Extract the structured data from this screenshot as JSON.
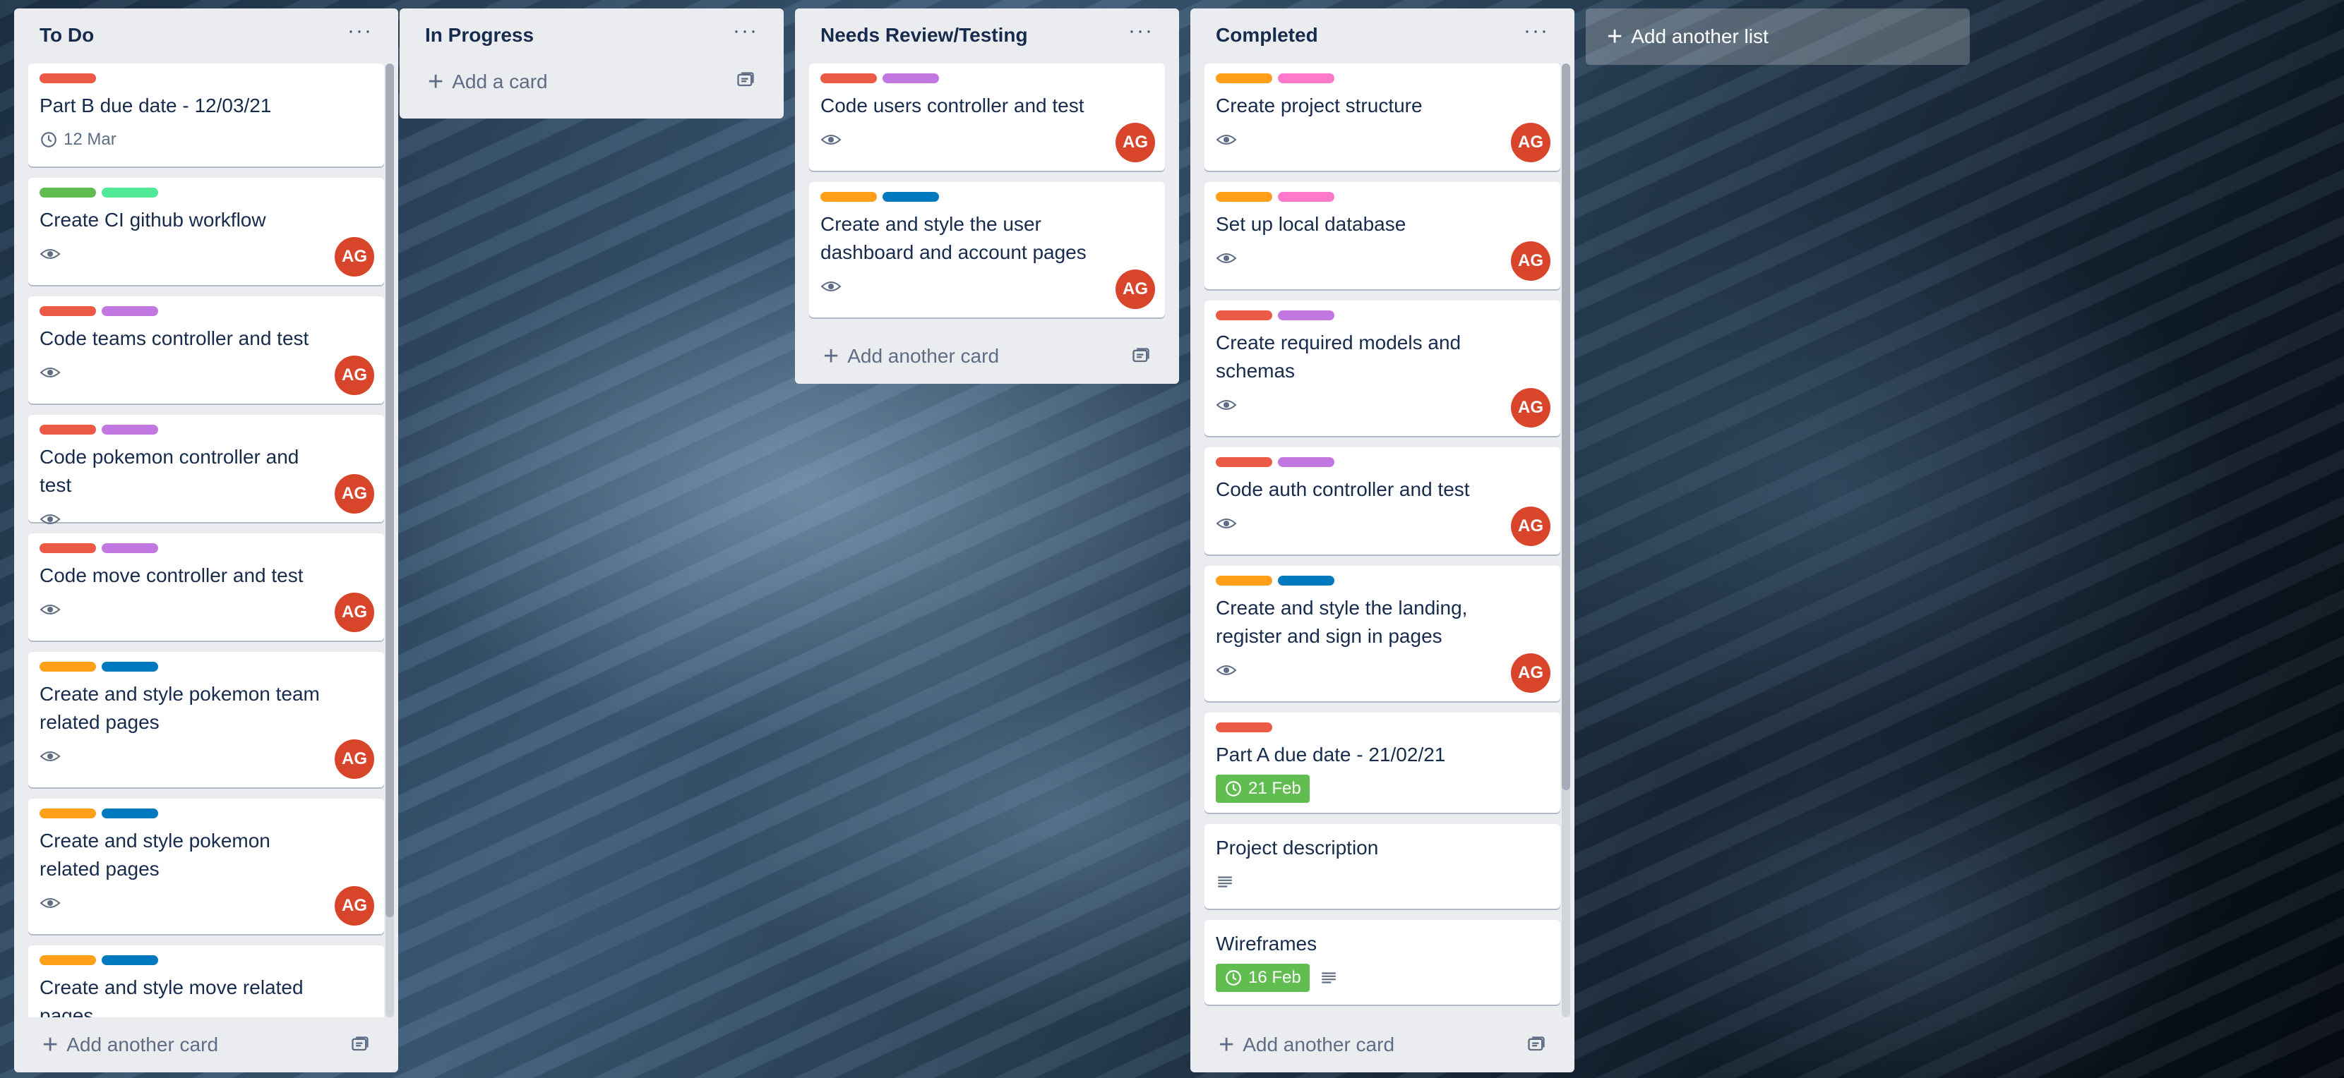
{
  "colors": {
    "red": "#eb5a46",
    "purple": "#c377e0",
    "green": "#61bd4f",
    "lime": "#51e898",
    "orange": "#ff9f1a",
    "pink": "#ff78cb",
    "blue": "#0079bf",
    "avatar": "#d9452b"
  },
  "icons": {
    "watch": "eye-icon",
    "due": "clock-icon",
    "description": "description-icon",
    "template": "card-template-icon",
    "menu": "ellipsis-icon",
    "add": "plus-icon"
  },
  "lists": [
    {
      "title": "To Do",
      "menu": "···",
      "add_label": "Add another card",
      "cards": [
        {
          "labels": [
            "red"
          ],
          "title": "Part B due date - 12/03/21",
          "due": "12 Mar",
          "due_complete": false,
          "watch": false,
          "avatar": ""
        },
        {
          "labels": [
            "green",
            "lime"
          ],
          "title": "Create CI github workflow",
          "watch": true,
          "avatar": "AG"
        },
        {
          "labels": [
            "red",
            "purple"
          ],
          "title": "Code teams controller and test",
          "watch": true,
          "avatar": "AG"
        },
        {
          "labels": [
            "red",
            "purple"
          ],
          "title": "Code pokemon controller and test",
          "watch": true,
          "avatar": "AG"
        },
        {
          "labels": [
            "red",
            "purple"
          ],
          "title": "Code move controller and test",
          "watch": true,
          "avatar": "AG"
        },
        {
          "labels": [
            "orange",
            "blue"
          ],
          "title": "Create and style pokemon team related pages",
          "watch": true,
          "avatar": "AG"
        },
        {
          "labels": [
            "orange",
            "blue"
          ],
          "title": "Create and style pokemon related pages",
          "watch": true,
          "avatar": "AG"
        },
        {
          "labels": [
            "orange",
            "blue"
          ],
          "title": "Create and style move related pages",
          "watch": false,
          "avatar": ""
        }
      ]
    },
    {
      "title": "In Progress",
      "menu": "···",
      "add_label": "Add a card",
      "cards": []
    },
    {
      "title": "Needs Review/Testing",
      "menu": "···",
      "add_label": "Add another card",
      "cards": [
        {
          "labels": [
            "red",
            "purple"
          ],
          "title": "Code users controller and test",
          "watch": true,
          "avatar": "AG"
        },
        {
          "labels": [
            "orange",
            "blue"
          ],
          "title": "Create and style the user dashboard and account pages",
          "watch": true,
          "avatar": "AG"
        }
      ]
    },
    {
      "title": "Completed",
      "menu": "···",
      "add_label": "Add another card",
      "cards": [
        {
          "labels": [
            "orange",
            "pink"
          ],
          "title": "Create project structure",
          "watch": true,
          "avatar": "AG"
        },
        {
          "labels": [
            "orange",
            "pink"
          ],
          "title": "Set up local database",
          "watch": true,
          "avatar": "AG"
        },
        {
          "labels": [
            "red",
            "purple"
          ],
          "title": "Create required models and schemas",
          "watch": true,
          "avatar": "AG"
        },
        {
          "labels": [
            "red",
            "purple"
          ],
          "title": "Code auth controller and test",
          "watch": true,
          "avatar": "AG"
        },
        {
          "labels": [
            "orange",
            "blue"
          ],
          "title": "Create and style the landing, register and sign in pages",
          "watch": true,
          "avatar": "AG"
        },
        {
          "labels": [
            "red"
          ],
          "title": "Part A due date - 21/02/21",
          "due": "21 Feb",
          "due_complete": true,
          "watch": false,
          "avatar": ""
        },
        {
          "labels": [],
          "title": "Project description",
          "description": true,
          "watch": false,
          "avatar": ""
        },
        {
          "labels": [],
          "title": "Wireframes",
          "due": "16 Feb",
          "due_complete": true,
          "description": true,
          "watch": false,
          "avatar": ""
        }
      ]
    }
  ],
  "add_list_label": "Add another list"
}
